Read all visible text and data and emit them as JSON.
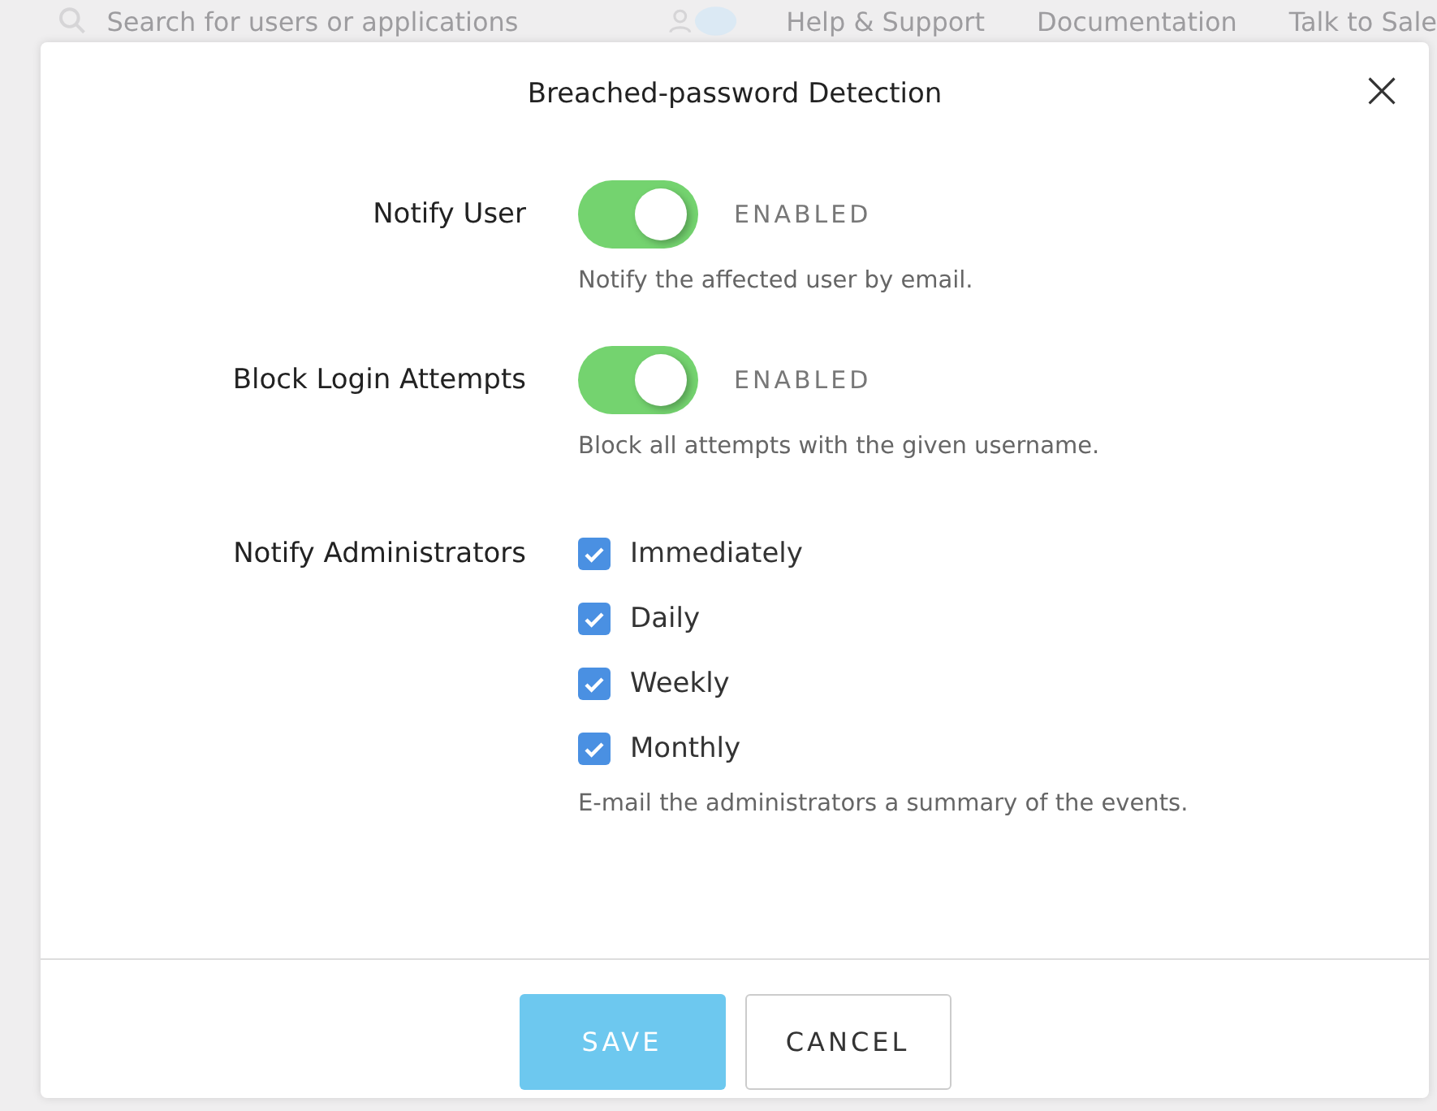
{
  "background": {
    "search_placeholder": "Search for users or applications",
    "links": [
      "Help & Support",
      "Documentation",
      "Talk to Sale"
    ]
  },
  "dialog": {
    "title": "Breached-password Detection",
    "close": "×",
    "settings": [
      {
        "kind": "toggle",
        "label": "Notify User",
        "on": true,
        "state_label": "ENABLED",
        "description": "Notify the affected user by email."
      },
      {
        "kind": "toggle",
        "label": "Block Login Attempts",
        "on": true,
        "state_label": "ENABLED",
        "description": "Block all attempts with the given username."
      },
      {
        "kind": "checkboxes",
        "label": "Notify Administrators",
        "options": [
          {
            "label": "Immediately",
            "checked": true
          },
          {
            "label": "Daily",
            "checked": true
          },
          {
            "label": "Weekly",
            "checked": true
          },
          {
            "label": "Monthly",
            "checked": true
          }
        ],
        "description": "E-mail the administrators a summary of the events."
      }
    ],
    "buttons": [
      {
        "kind": "primary",
        "label": "SAVE",
        "disabled": true
      },
      {
        "kind": "secondary",
        "label": "CANCEL",
        "disabled": false
      }
    ]
  }
}
